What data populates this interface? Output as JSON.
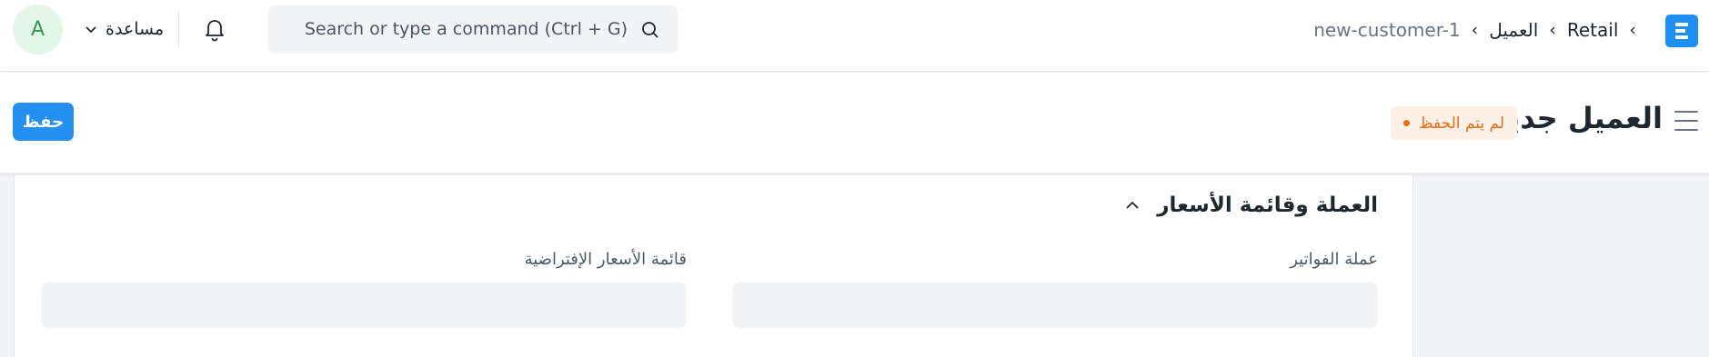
{
  "navbar": {
    "breadcrumbs": [
      {
        "label": "Retail"
      },
      {
        "label": "العميل"
      },
      {
        "label": "new-customer-1"
      }
    ],
    "search": {
      "placeholder": "Search or type a command (Ctrl + G)"
    },
    "help_label": "مساعدة",
    "avatar_initial": "A"
  },
  "page": {
    "title": "العميل جديد",
    "status": "لم يتم الحفظ",
    "save_label": "حفظ"
  },
  "form": {
    "section_title": "العملة وقائمة الأسعار",
    "fields": [
      {
        "label": "عملة الفواتير",
        "value": ""
      },
      {
        "label": "قائمة الأسعار الإفتراضية",
        "value": ""
      }
    ]
  },
  "colors": {
    "accent": "#2490ef",
    "status_text": "#e86c13",
    "status_bg": "#fdf1e7",
    "avatar_bg": "#e4f5e9",
    "avatar_text": "#2d9c4f"
  }
}
